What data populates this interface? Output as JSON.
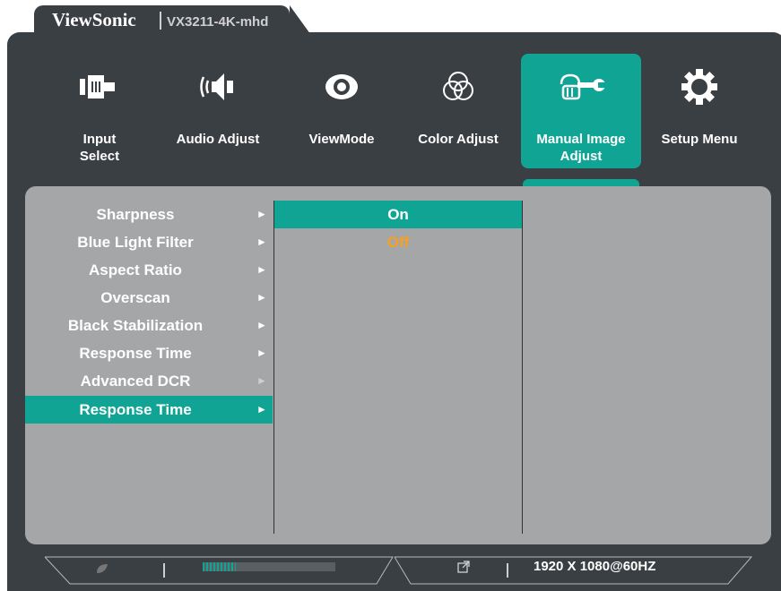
{
  "brand": {
    "name": "ViewSonic",
    "model": "VX3211-4K-mhd"
  },
  "nav": [
    {
      "label_line1": "Input",
      "label_line2": "Select",
      "icon": "input-select-icon",
      "active": false
    },
    {
      "label_line1": "Audio Adjust",
      "label_line2": "",
      "icon": "speaker-icon",
      "active": false
    },
    {
      "label_line1": "ViewMode",
      "label_line2": "",
      "icon": "eye-icon",
      "active": false
    },
    {
      "label_line1": "Color Adjust",
      "label_line2": "",
      "icon": "color-circles-icon",
      "active": false
    },
    {
      "label_line1": "Manual Image",
      "label_line2": "Adjust",
      "icon": "hand-wrench-icon",
      "active": true
    },
    {
      "label_line1": "Setup Menu",
      "label_line2": "",
      "icon": "gear-icon",
      "active": false
    }
  ],
  "menu": {
    "items": [
      {
        "label": "Sharpness",
        "arrow": "►"
      },
      {
        "label": "Blue Light Filter",
        "arrow": "►"
      },
      {
        "label": "Aspect Ratio",
        "arrow": "►"
      },
      {
        "label": "Overscan",
        "arrow": "►"
      },
      {
        "label": "Black Stabilization",
        "arrow": "►"
      },
      {
        "label": "Response Time",
        "arrow": "►"
      },
      {
        "label": "Advanced DCR",
        "arrow": "►"
      },
      {
        "label": "Response Time",
        "arrow": "►"
      }
    ],
    "selected_index": 7
  },
  "options": {
    "items": [
      {
        "label": "On"
      },
      {
        "label": "Off"
      }
    ],
    "highlighted_index": 0,
    "current_index": 1
  },
  "status": {
    "eco_icon": "eco-leaf-icon",
    "link_icon": "external-link-icon",
    "resolution": "1920 X 1080@60HZ",
    "level_fraction": 0.25
  },
  "colors": {
    "frame": "#3a3f44",
    "accent": "#10a495",
    "panel": "#a5a6a8",
    "current_value": "#f7a01d"
  }
}
